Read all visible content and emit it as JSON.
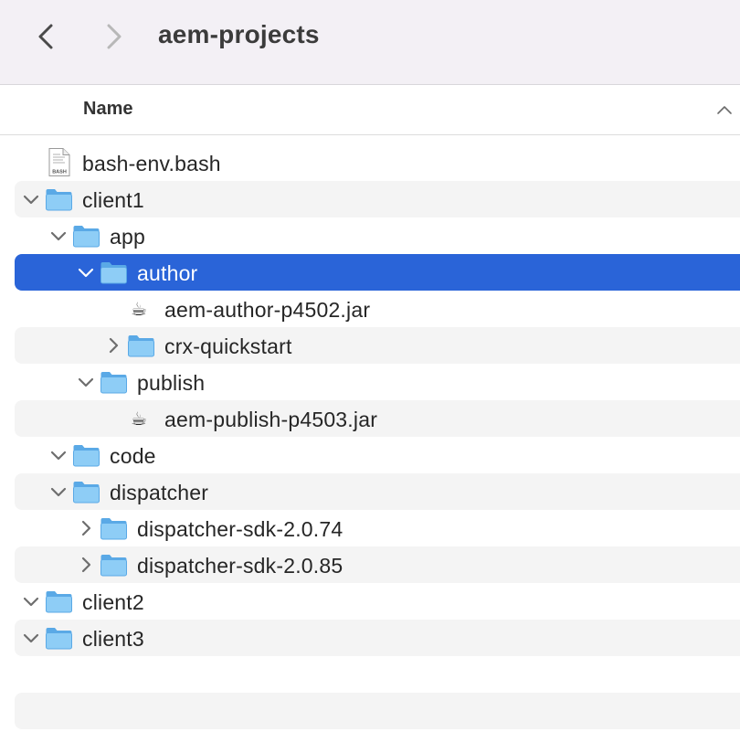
{
  "window": {
    "title": "aem-projects"
  },
  "toolbar": {
    "back_icon": "chevron-left-icon",
    "forward_icon": "chevron-right-icon"
  },
  "header": {
    "name_column": "Name",
    "sort_icon": "chevron-up-icon"
  },
  "colors": {
    "selection": "#2a64d8",
    "folder_light": "#8ecdf6",
    "folder_dark": "#5aa9e6",
    "stripe": "#f4f4f4"
  },
  "rows": [
    {
      "label": "bash-env.bash",
      "kind": "file",
      "depth": 0
    },
    {
      "label": "client1",
      "kind": "folder",
      "expanded": true,
      "depth": 0
    },
    {
      "label": "app",
      "kind": "folder",
      "expanded": true,
      "depth": 1
    },
    {
      "label": "author",
      "kind": "folder",
      "expanded": true,
      "depth": 2,
      "selected": true
    },
    {
      "label": "aem-author-p4502.jar",
      "kind": "jar",
      "depth": 3
    },
    {
      "label": "crx-quickstart",
      "kind": "folder",
      "expanded": false,
      "depth": 3
    },
    {
      "label": "publish",
      "kind": "folder",
      "expanded": true,
      "depth": 2
    },
    {
      "label": "aem-publish-p4503.jar",
      "kind": "jar",
      "depth": 3
    },
    {
      "label": "code",
      "kind": "folder",
      "expanded": true,
      "depth": 1
    },
    {
      "label": "dispatcher",
      "kind": "folder",
      "expanded": true,
      "depth": 1
    },
    {
      "label": "dispatcher-sdk-2.0.74",
      "kind": "folder",
      "expanded": false,
      "depth": 2
    },
    {
      "label": "dispatcher-sdk-2.0.85",
      "kind": "folder",
      "expanded": false,
      "depth": 2
    },
    {
      "label": "client2",
      "kind": "folder",
      "expanded": true,
      "depth": 0
    },
    {
      "label": "client3",
      "kind": "folder",
      "expanded": true,
      "depth": 0
    }
  ],
  "file_badge": "BASH"
}
